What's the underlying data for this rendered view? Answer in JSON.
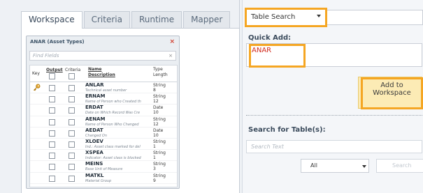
{
  "tabs": [
    {
      "label": "Workspace"
    },
    {
      "label": "Criteria"
    },
    {
      "label": "Runtime"
    },
    {
      "label": "Mapper"
    }
  ],
  "entity": {
    "title": "ANAR (Asset Types)",
    "close_symbol": "×",
    "find_placeholder": "Find Fields",
    "find_clear": "×",
    "headers": {
      "key": "Key",
      "output": "Output",
      "criteria": "Criteria",
      "name": "Name",
      "description": "Description",
      "type": "Type",
      "length": "Length"
    },
    "rows": [
      {
        "name": "ANLAR",
        "desc": "Technical asset number",
        "type": "String",
        "len": "8",
        "is_key": true
      },
      {
        "name": "ERNAM",
        "desc": "Name of Person who Created th",
        "type": "String",
        "len": "12",
        "is_key": false
      },
      {
        "name": "ERDAT",
        "desc": "Date on Which Record Was Cre",
        "type": "Date",
        "len": "10",
        "is_key": false
      },
      {
        "name": "AENAM",
        "desc": "Name of Person Who Changed",
        "type": "String",
        "len": "12",
        "is_key": false
      },
      {
        "name": "AEDAT",
        "desc": "Changed On",
        "type": "Date",
        "len": "10",
        "is_key": false
      },
      {
        "name": "XLOEV",
        "desc": "Ind.: Asset class marked for del",
        "type": "String",
        "len": "1",
        "is_key": false
      },
      {
        "name": "XSPEA",
        "desc": "Indicator: Asset class is blocked",
        "type": "String",
        "len": "1",
        "is_key": false
      },
      {
        "name": "MEINS",
        "desc": "Base Unit of Measure",
        "type": "String",
        "len": "3",
        "is_key": false
      },
      {
        "name": "MATKL",
        "desc": "Material Group",
        "type": "String",
        "len": "9",
        "is_key": false
      }
    ]
  },
  "right": {
    "search_mode": "Table Search",
    "quick_add_label": "Quick Add:",
    "quick_add_value": "ANAR",
    "add_button_line1": "Add to",
    "add_button_line2": "Workspace",
    "search_tables_label": "Search for Table(s):",
    "search_placeholder": "Search Text",
    "filter_value": "All",
    "search_button": "Search"
  },
  "colors": {
    "highlight": "#f5a623",
    "close_red": "#d23b2b",
    "quick_add_text": "#d0281b",
    "add_button_bg": "#fcebb5"
  }
}
